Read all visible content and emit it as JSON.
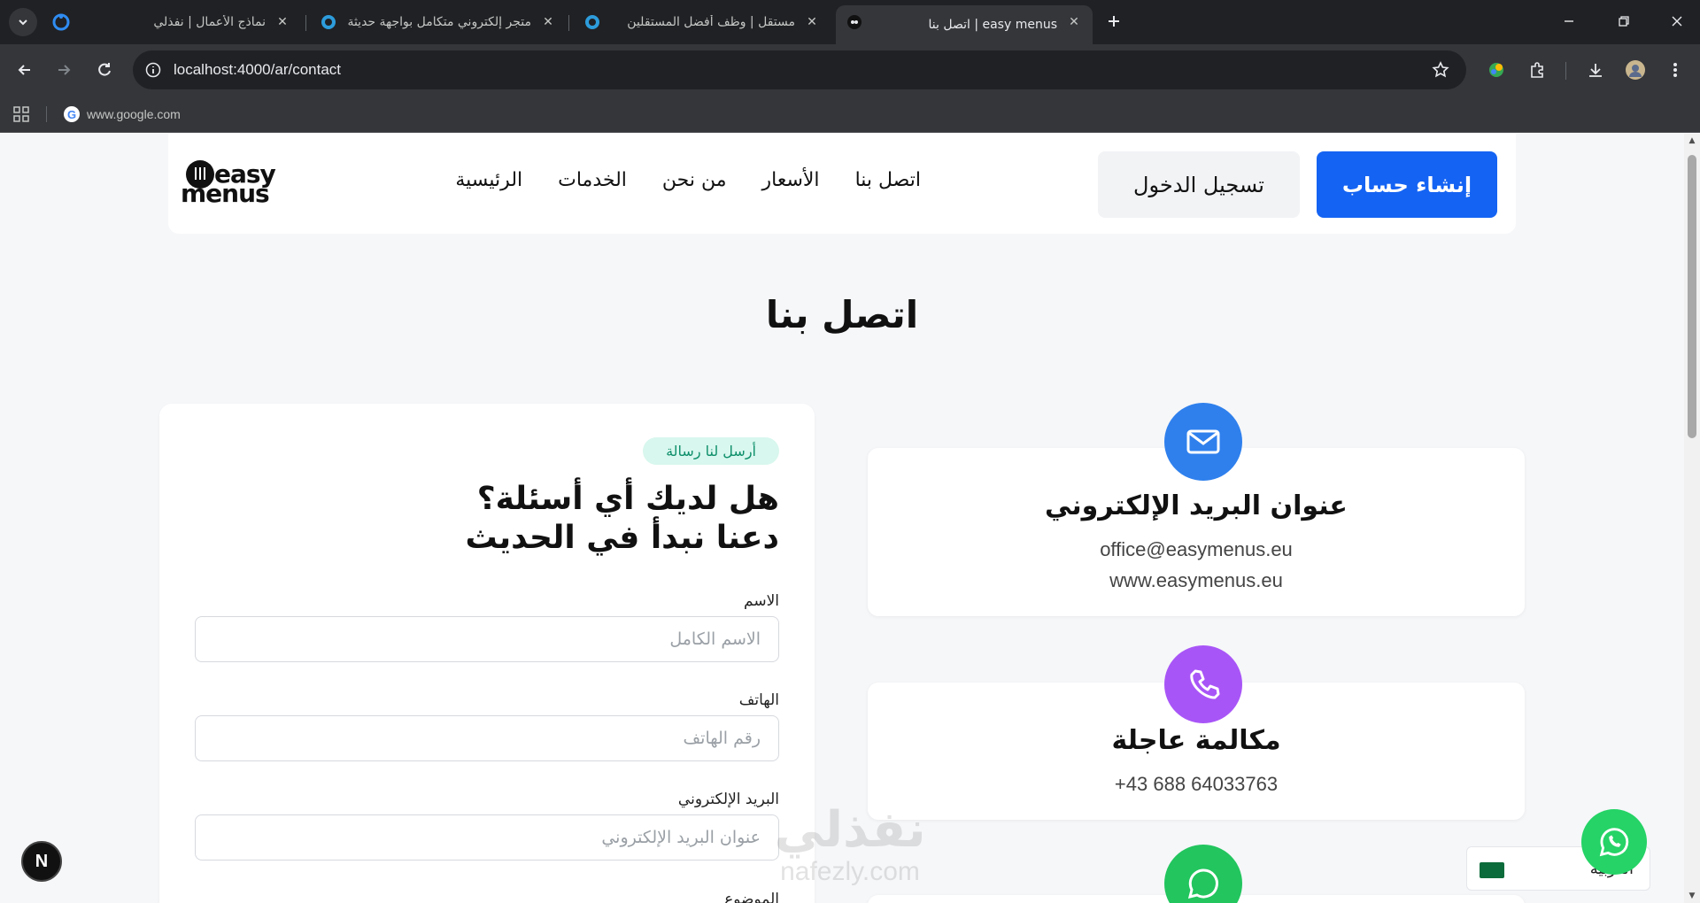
{
  "browser": {
    "tabs": [
      {
        "title": "نماذج الأعمال | نفذلي",
        "active": false
      },
      {
        "title": "متجر إلكتروني متكامل بواجهة حديثة",
        "active": false
      },
      {
        "title": "مستقل | وظف أفضل المستقلين",
        "active": false
      },
      {
        "title": "easy menus | اتصل بنا",
        "active": true
      }
    ],
    "url": "localhost:4000/ar/contact",
    "bookmark": "www.google.com"
  },
  "nav": {
    "logo_top": "easy",
    "logo_bottom": "menus",
    "links": [
      "اتصل بنا",
      "الأسعار",
      "من نحن",
      "الخدمات",
      "الرئيسية"
    ],
    "login_label": "تسجيل الدخول",
    "signup_label": "إنشاء حساب"
  },
  "page": {
    "title": "اتصل بنا"
  },
  "form": {
    "badge": "أرسل لنا رسالة",
    "heading_line1": "هل لديك أي أسئلة؟",
    "heading_line2": "دعنا نبدأ في الحديث",
    "fields": [
      {
        "label": "الاسم",
        "placeholder": "الاسم الكامل"
      },
      {
        "label": "الهاتف",
        "placeholder": "رقم الهاتف"
      },
      {
        "label": "البريد الإلكتروني",
        "placeholder": "عنوان البريد الإلكتروني"
      },
      {
        "label": "الموضوع",
        "placeholder": ""
      }
    ]
  },
  "info": {
    "email": {
      "title": "عنوان البريد الإلكتروني",
      "line1": "office@easymenus.eu",
      "line2": "www.easymenus.eu",
      "color": "#2f80ed"
    },
    "phone": {
      "title": "مكالمة عاجلة",
      "line1": "+43 688 64033763",
      "color": "#a855f7"
    },
    "whatsapp": {
      "color": "#22c55e"
    }
  },
  "language": {
    "selected": "العربية"
  },
  "watermark": {
    "arabic": "نفذلي",
    "latin": "nafezly.com"
  },
  "dev_badge": "N"
}
